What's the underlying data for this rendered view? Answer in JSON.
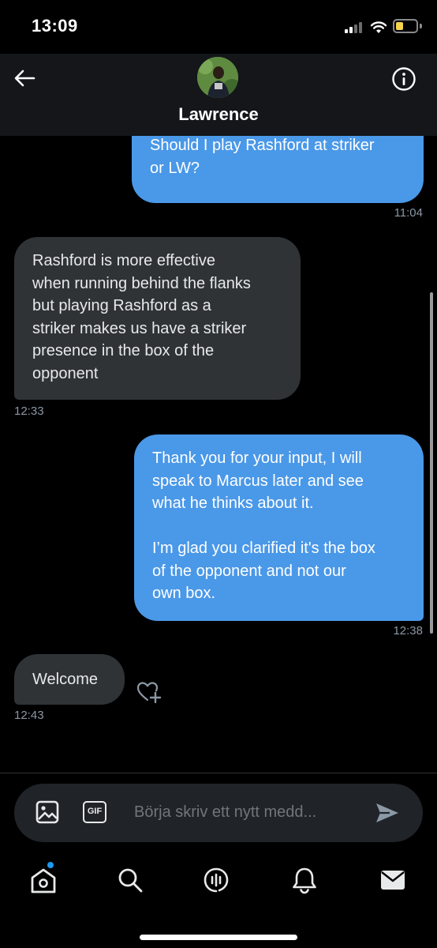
{
  "status_bar": {
    "time": "13:09",
    "battery_color": "#f5d34b"
  },
  "header": {
    "contact_name": "Lawrence"
  },
  "messages": [
    {
      "direction": "sent",
      "lines": [
        "Should I play Rashford at striker",
        "or LW?"
      ],
      "time": "11:04"
    },
    {
      "direction": "received",
      "lines": [
        "Rashford is more effective",
        "when running behind the flanks",
        "but playing Rashford as a",
        "striker makes us have a striker",
        "presence in the box of the",
        "opponent"
      ],
      "time": "12:33"
    },
    {
      "direction": "sent",
      "lines": [
        "Thank you for your input, I will",
        "speak to Marcus later and see",
        "what he thinks about it.",
        "",
        "I’m glad you clarified it's the box",
        "of the opponent and not our",
        "own box."
      ],
      "time": "12:38"
    },
    {
      "direction": "received",
      "lines": [
        "Welcome"
      ],
      "time": "12:43"
    }
  ],
  "composer": {
    "placeholder": "Börja skriv ett nytt medd...",
    "gif_label": "GIF",
    "media_icon": "image-icon",
    "send_icon": "send-icon"
  },
  "tabbar": {
    "items": [
      "home-icon",
      "search-icon",
      "spaces-icon",
      "notifications-icon",
      "messages-icon"
    ],
    "home_has_notification_dot": true
  },
  "colors": {
    "sent_bubble": "#4a98e8",
    "received_bubble": "#2f3336",
    "background": "#000000",
    "accent": "#1d9bf0"
  }
}
